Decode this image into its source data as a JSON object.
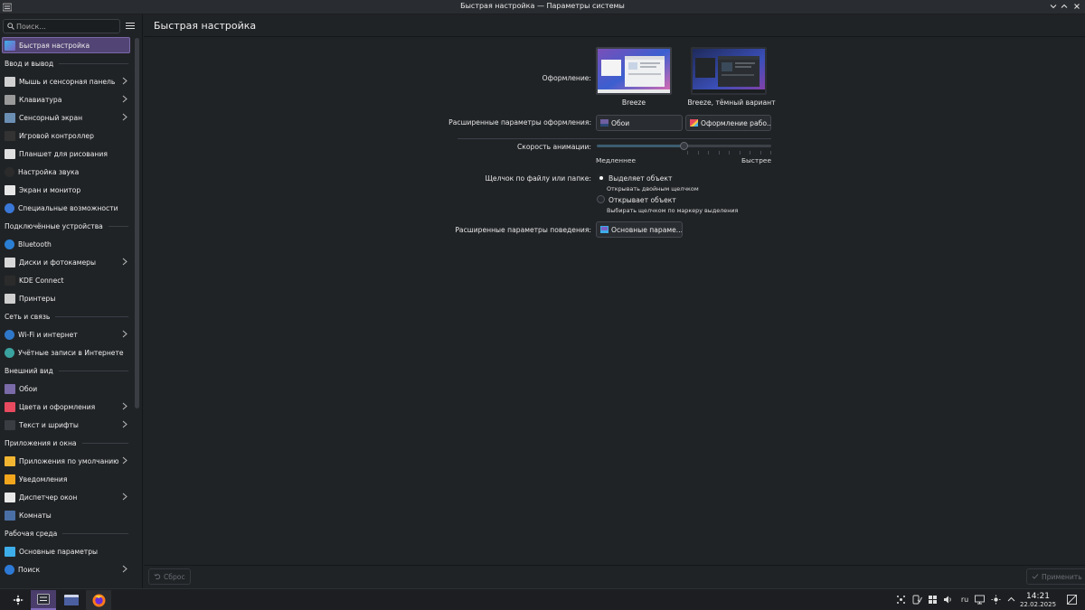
{
  "window": {
    "title": "Быстрая настройка — Параметры системы"
  },
  "sidebar": {
    "search_placeholder": "Поиск...",
    "selected": {
      "label": "Быстрая настройка",
      "icon": "quick-settings-icon",
      "color": "#3daee9"
    },
    "sections": [
      {
        "title": "Ввод и вывод",
        "items": [
          {
            "label": "Мышь и сенсорная панель",
            "icon": "mouse-icon",
            "color": "#d0d0d0",
            "chevron": true
          },
          {
            "label": "Клавиатура",
            "icon": "keyboard-icon",
            "color": "#9a9a9a",
            "chevron": true
          },
          {
            "label": "Сенсорный экран",
            "icon": "touchscreen-icon",
            "color": "#6b8fb3",
            "chevron": true
          },
          {
            "label": "Игровой контроллер",
            "icon": "gamepad-icon",
            "color": "#333",
            "chevron": false
          },
          {
            "label": "Планшет для рисования",
            "icon": "tablet-icon",
            "color": "#e0e0e0",
            "chevron": false
          },
          {
            "label": "Настройка звука",
            "icon": "audio-icon",
            "color": "#2b2b2b",
            "chevron": false
          },
          {
            "label": "Экран и монитор",
            "icon": "display-icon",
            "color": "#e6e6e6",
            "chevron": false
          },
          {
            "label": "Специальные возможности",
            "icon": "accessibility-icon",
            "color": "#3a78d8",
            "chevron": false
          }
        ]
      },
      {
        "title": "Подключённые устройства",
        "items": [
          {
            "label": "Bluetooth",
            "icon": "bluetooth-icon",
            "color": "#2a7fd4",
            "chevron": false
          },
          {
            "label": "Диски и фотокамеры",
            "icon": "drive-icon",
            "color": "#d8d8d8",
            "chevron": true
          },
          {
            "label": "KDE Connect",
            "icon": "kdeconnect-icon",
            "color": "#2b2b2b",
            "chevron": false
          },
          {
            "label": "Принтеры",
            "icon": "printer-icon",
            "color": "#cfcfcf",
            "chevron": false
          }
        ]
      },
      {
        "title": "Сеть и связь",
        "items": [
          {
            "label": "Wi-Fi и интернет",
            "icon": "wifi-icon",
            "color": "#2f78c9",
            "chevron": true
          },
          {
            "label": "Учётные записи в Интернете",
            "icon": "online-accounts-icon",
            "color": "#3aa3a0",
            "chevron": false
          }
        ]
      },
      {
        "title": "Внешний вид",
        "items": [
          {
            "label": "Обои",
            "icon": "wallpaper-icon",
            "color": "#7a6aa8",
            "chevron": false
          },
          {
            "label": "Цвета и оформления",
            "icon": "colors-icon",
            "color": "#e84a5f",
            "chevron": true
          },
          {
            "label": "Текст и шрифты",
            "icon": "fonts-icon",
            "color": "#3a3d42",
            "chevron": true
          }
        ]
      },
      {
        "title": "Приложения и окна",
        "items": [
          {
            "label": "Приложения по умолчанию",
            "icon": "star-icon",
            "color": "#f2b531",
            "chevron": true
          },
          {
            "label": "Уведомления",
            "icon": "bell-icon",
            "color": "#f2a61d",
            "chevron": false
          },
          {
            "label": "Диспетчер окон",
            "icon": "window-manager-icon",
            "color": "#e8e8e8",
            "chevron": true
          },
          {
            "label": "Комнаты",
            "icon": "activities-icon",
            "color": "#4a6fa5",
            "chevron": false
          }
        ]
      },
      {
        "title": "Рабочая среда",
        "items": [
          {
            "label": "Основные параметры",
            "icon": "workspace-icon",
            "color": "#3daee9",
            "chevron": false
          },
          {
            "label": "Поиск",
            "icon": "search-settings-icon",
            "color": "#2d7ad6",
            "chevron": true
          }
        ]
      }
    ]
  },
  "main": {
    "header": "Быстрая настройка",
    "theme": {
      "label": "Оформление:",
      "options": [
        {
          "caption": "Breeze",
          "selected": true
        },
        {
          "caption": "Breeze, тёмный вариант",
          "selected": false
        }
      ]
    },
    "advanced_appearance": {
      "label": "Расширенные параметры оформления:",
      "wallpaper_button": "Обои",
      "theme_button": "Оформление рабо..."
    },
    "animation": {
      "label": "Скорость анимации:",
      "min_label": "Медленнее",
      "max_label": "Быстрее",
      "value_fraction": 0.5
    },
    "click_behavior": {
      "label": "Щелчок по файлу или папке:",
      "options": [
        {
          "label": "Выделяет объект",
          "hint": "Открывать двойным щелчком",
          "checked": true
        },
        {
          "label": "Открывает объект",
          "hint": "Выбирать щелчком по маркеру выделения",
          "checked": false
        }
      ]
    },
    "advanced_behavior": {
      "label": "Расширенные параметры поведения:",
      "button": "Основные параме..."
    }
  },
  "footer": {
    "reset": "Сброс",
    "apply": "Применить"
  },
  "taskbar": {
    "keyboard_layout": "ru",
    "time": "14:21",
    "date": "22.02.2025"
  }
}
